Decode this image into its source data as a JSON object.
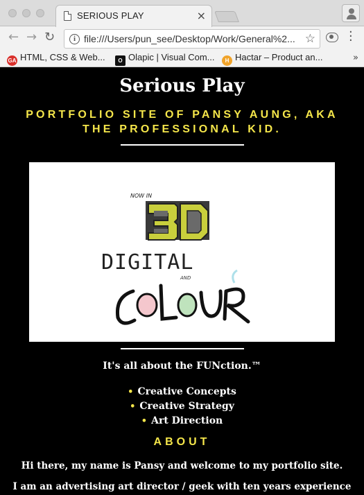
{
  "browser": {
    "tab_title": "SERIOUS PLAY",
    "tab_close": "×",
    "url": "file:///Users/pun_see/Desktop/Work/General%2...",
    "back_icon": "arrow-left-icon",
    "forward_icon": "arrow-right-icon",
    "reload_icon": "reload-icon",
    "bookmarks": [
      {
        "label": "HTML, CSS & Web...",
        "icon": "ga-icon",
        "icon_color": "#d9302b",
        "icon_text": "GA"
      },
      {
        "label": "Olapic | Visual Com...",
        "icon": "olapic-icon",
        "icon_color": "#111111",
        "icon_text": "O"
      },
      {
        "label": "Hactar – Product an...",
        "icon": "hactar-icon",
        "icon_color": "#f0a32a",
        "icon_text": "H"
      }
    ],
    "bookmarks_more": "»"
  },
  "page": {
    "title": "Serious Play",
    "subtitle": "PORTFOLIO SITE OF PANSY AUNG, AKA THE PROFESSIONAL KID.",
    "hero": {
      "small_text": "NOW IN",
      "big_text": "3D",
      "digital": "DIGITAL",
      "and": "AND",
      "colour": "COLOUR"
    },
    "tagline": "It's all about the FUNction.™",
    "services": [
      "Creative Concepts",
      "Creative Strategy",
      "Art Direction"
    ],
    "about_heading": "ABOUT",
    "about_p1": "Hi there, my name is Pansy and welcome to my portfolio site.",
    "about_p2": "I am an advertising art director / geek with ten years experience"
  },
  "colors": {
    "accent": "#f5e64a",
    "background": "#000000",
    "text": "#ffffff"
  }
}
